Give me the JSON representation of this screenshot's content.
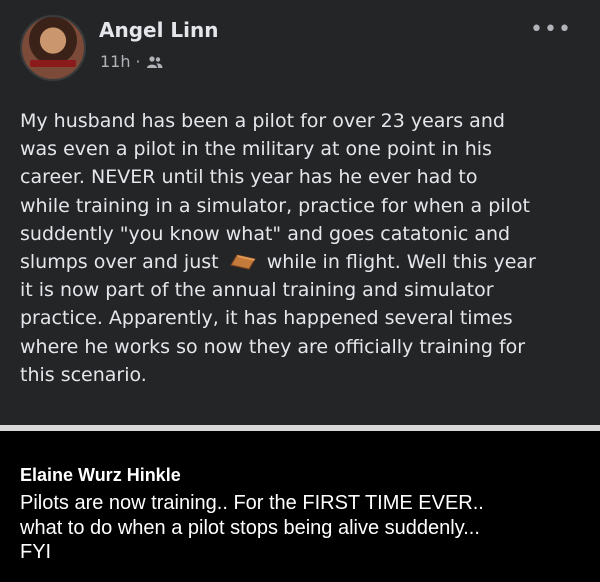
{
  "post": {
    "author": "Angel Linn",
    "time": "11h",
    "dot": "·",
    "audience_icon": "friends-icon",
    "more_icon": "more-options-icon",
    "avatar_icon": "profile-photo",
    "lines": [
      "My husband has been a pilot for over 23 years and",
      "was even a pilot in the military at one point in his",
      "career. NEVER until this year has he ever had to",
      "while training in a simulator, practice for when a pilot",
      "suddently \"you know what\" and goes catatonic and",
      "it is now part of the annual training and simulator",
      "practice. Apparently, it has happened several times",
      "where he works so now they are officially training for",
      "this scenario."
    ],
    "emoji_line": {
      "before": "slumps over and just",
      "emoji": "coffin-emoji",
      "after": "while in flight. Well this year"
    }
  },
  "caption": {
    "name": "Elaine Wurz Hinkle",
    "lines": [
      "Pilots are now training.. For the FIRST TIME EVER..",
      "what to do when a pilot stops being alive suddenly...",
      "FYI"
    ]
  },
  "colors": {
    "post_bg": "#242526",
    "text": "#e4e6eb",
    "meta": "#b0b3b8",
    "caption_bg": "#000000"
  }
}
